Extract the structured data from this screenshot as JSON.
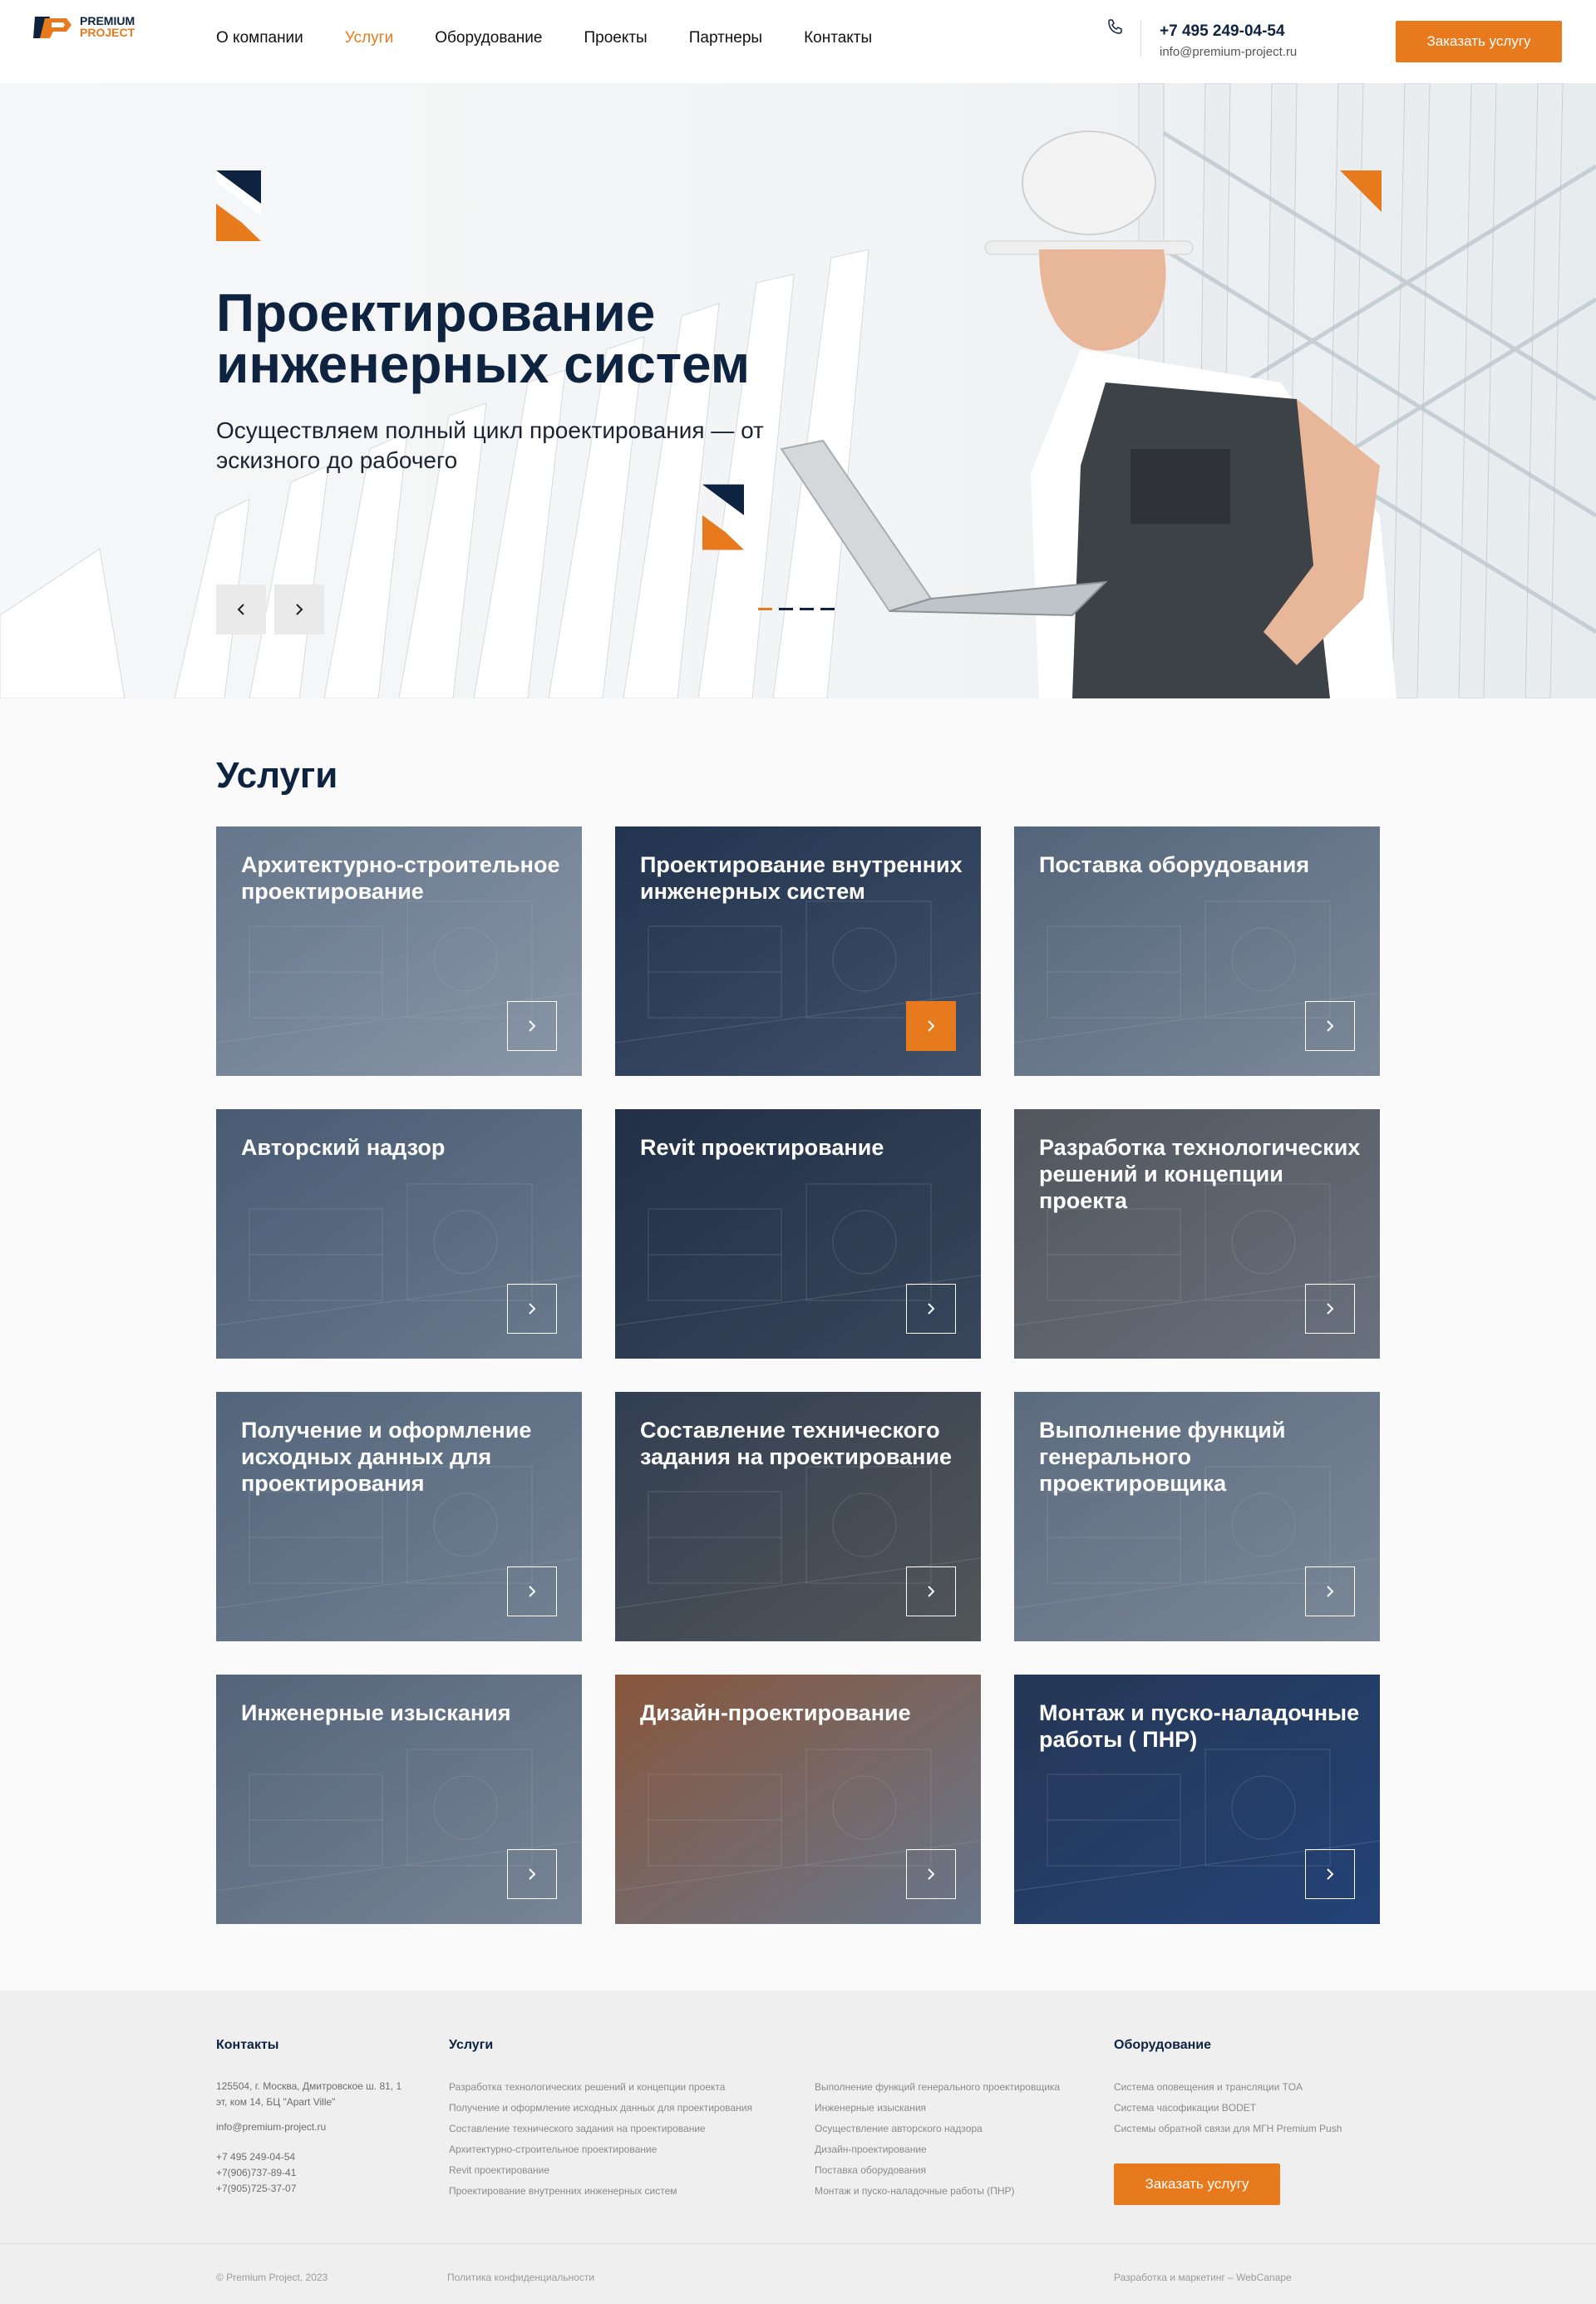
{
  "header": {
    "logo_line1": "PREMIUM",
    "logo_line2": "PROJECT",
    "nav": [
      "О компании",
      "Услуги",
      "Оборудование",
      "Проекты",
      "Партнеры",
      "Контакты"
    ],
    "active_nav": "Услуги",
    "phone": "+7 495 249-04-54",
    "email": "info@premium-project.ru",
    "cta": "Заказать услугу",
    "phone_icon": "phone-icon"
  },
  "hero": {
    "title": "Проектирование инженерных систем",
    "subtitle": "Осуществляем полный цикл проектирования — от эскизного до рабочего",
    "prev_icon": "chevron-left-icon",
    "next_icon": "chevron-right-icon",
    "slides_total": 4,
    "slide_active": 1
  },
  "services": {
    "title": "Услуги",
    "items": [
      {
        "title": "Архитектурно-строительное проектирование",
        "highlight": false
      },
      {
        "title": "Проектирование внутренних инженерных систем",
        "highlight": true
      },
      {
        "title": "Поставка оборудования",
        "highlight": false
      },
      {
        "title": "Авторский надзор",
        "highlight": false
      },
      {
        "title": "Revit проектирование",
        "highlight": false
      },
      {
        "title": "Разработка технологических решений и концепции проекта",
        "highlight": false
      },
      {
        "title": "Получение и оформление исходных данных для проектирования",
        "highlight": false
      },
      {
        "title": "Составление технического задания на проектирование",
        "highlight": false
      },
      {
        "title": "Выполнение функций генерального проектировщика",
        "highlight": false
      },
      {
        "title": "Инженерные изыскания",
        "highlight": false
      },
      {
        "title": "Дизайн-проектирование",
        "highlight": false
      },
      {
        "title": "Монтаж и пуско-наладочные работы ( ПНР)",
        "highlight": false
      }
    ]
  },
  "footer": {
    "contacts_title": "Контакты",
    "address": "125504, г. Москва, Дмитровское ш. 81, 1 эт, ком 14, БЦ \"Apart Ville\"",
    "email": "info@premium-project.ru",
    "phones": [
      "+7 495 249-04-54",
      "+7(906)737-89-41",
      "+7(905)725-37-07"
    ],
    "services_title": "Услуги",
    "services_col1": [
      "Разработка технологических решений и концепции проекта",
      "Получение и оформление исходных данных для проектирования",
      "Составление технического задания на проектирование",
      "Архитектурно-строительное проектирование",
      "Revit проектирование",
      "Проектирование внутренних инженерных систем"
    ],
    "services_col2": [
      "Выполнение функций генерального проектировщика",
      "Инженерные изыскания",
      "Осуществление авторского надзора",
      "Дизайн-проектирование",
      "Поставка оборудования",
      "Монтаж и пуско-наладочные работы (ПНР)"
    ],
    "equipment_title": "Оборудование",
    "equipment": [
      "Система оповещения и трансляции TOA",
      "Система часофикации BODET",
      "Системы обратной связи для МГН Premium Push"
    ],
    "cta": "Заказать услугу",
    "copyright": "© Premium Project, 2023",
    "privacy": "Политика конфиденциальности",
    "credits": "Разработка и маркетинг – WebCanape"
  },
  "colors": {
    "accent": "#e87a1e",
    "navy": "#0d2340"
  }
}
